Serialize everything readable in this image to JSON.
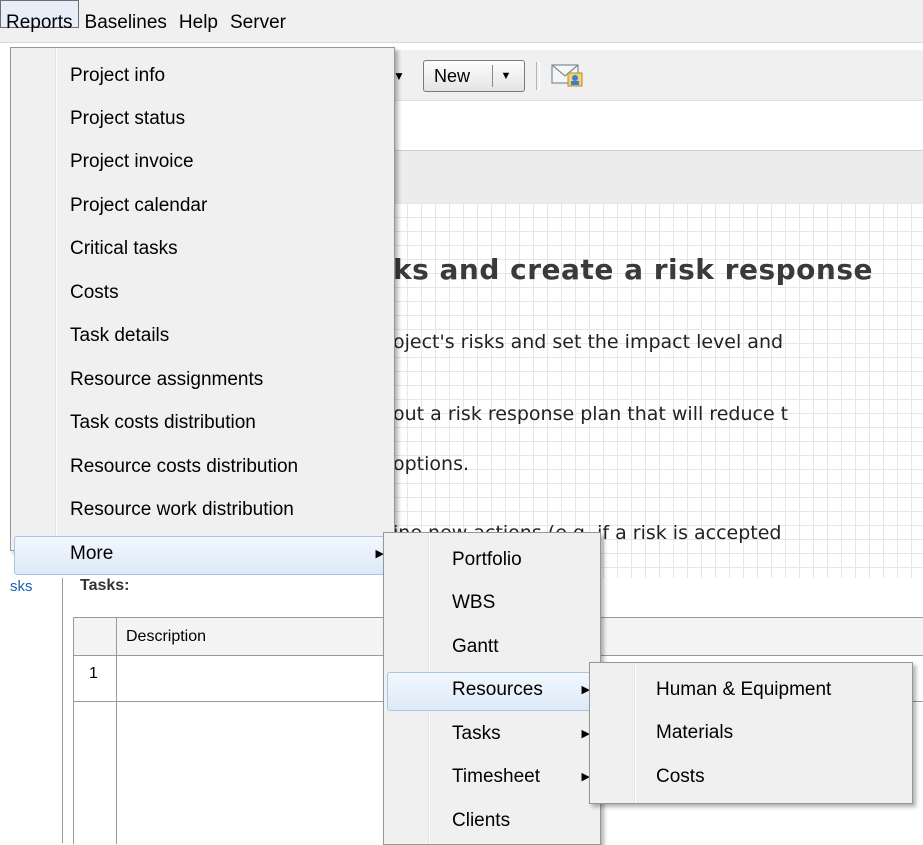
{
  "menubar": {
    "items": [
      "Reports",
      "Baselines",
      "Help",
      "Server"
    ]
  },
  "toolbar": {
    "new_label": "New"
  },
  "paper": {
    "heading": "ks and create a risk response",
    "lines": [
      "oject's risks and set the impact level and",
      "out a risk response plan that will reduce t",
      " options.",
      "ine new actions (e.g. if a risk is accepted"
    ]
  },
  "tasks_panel": {
    "link_text": "sks",
    "label": "Tasks:",
    "grid": {
      "column_header": "Description",
      "row_number": "1"
    }
  },
  "reports_menu": {
    "items": [
      "Project info",
      "Project status",
      "Project invoice",
      "Project calendar",
      "Critical tasks",
      "Costs",
      "Task details",
      "Resource assignments",
      "Task costs distribution",
      "Resource costs distribution",
      "Resource work distribution",
      "More"
    ]
  },
  "more_menu": {
    "items": [
      "Portfolio",
      "WBS",
      "Gantt",
      "Resources",
      "Tasks",
      "Timesheet",
      "Clients"
    ]
  },
  "resources_menu": {
    "items": [
      "Human & Equipment",
      "Materials",
      "Costs"
    ]
  },
  "colors": {
    "highlight_border": "#a6c5ea",
    "link": "#1e5fb4"
  },
  "icons": {
    "submenu_arrow": "triangle-right",
    "email": "envelope-icon"
  }
}
